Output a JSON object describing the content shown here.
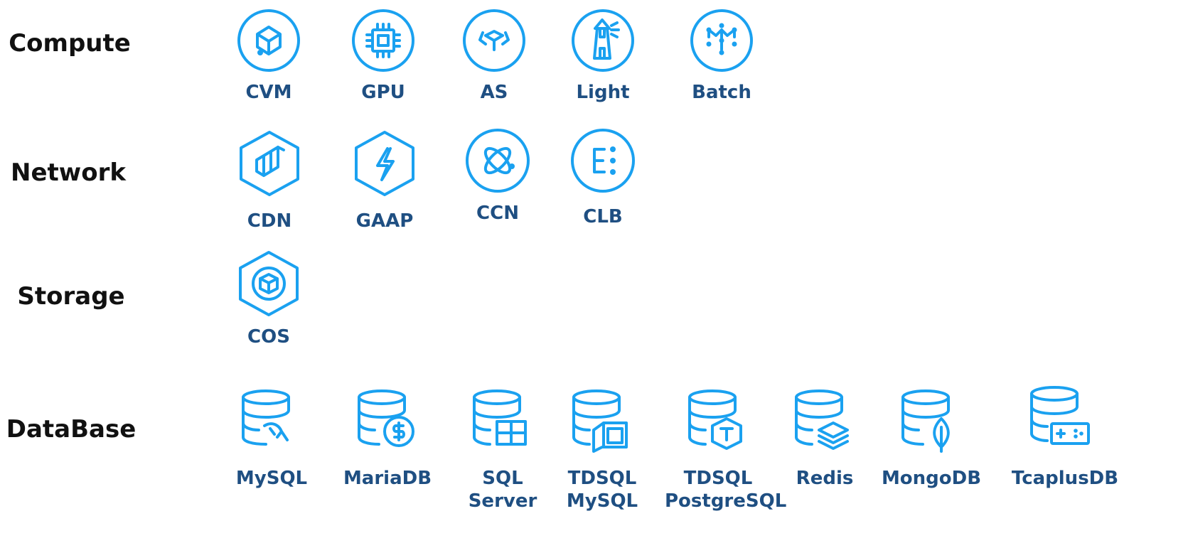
{
  "categories": {
    "compute": "Compute",
    "network": "Network",
    "storage": "Storage",
    "database": "DataBase"
  },
  "compute": [
    {
      "label": "CVM",
      "icon": "cvm-cube-icon"
    },
    {
      "label": "GPU",
      "icon": "chip-icon"
    },
    {
      "label": "AS",
      "icon": "auto-scaling-icon"
    },
    {
      "label": "Light",
      "icon": "lighthouse-icon"
    },
    {
      "label": "Batch",
      "icon": "batch-network-icon"
    }
  ],
  "network": [
    {
      "label": "CDN",
      "icon": "cdn-layers-icon"
    },
    {
      "label": "GAAP",
      "icon": "lightning-icon"
    },
    {
      "label": "CCN",
      "icon": "atom-icon"
    },
    {
      "label": "CLB",
      "icon": "load-balancer-icon"
    }
  ],
  "storage": [
    {
      "label": "COS",
      "icon": "storage-box-icon"
    }
  ],
  "database": [
    {
      "label": "MySQL",
      "icon": "mysql-dolphin-icon"
    },
    {
      "label": "MariaDB",
      "icon": "mariadb-dollar-icon"
    },
    {
      "label": "SQL\nServer",
      "icon": "sql-server-grid-icon"
    },
    {
      "label": "TDSQL\nMySQL",
      "icon": "tdsql-mysql-icon"
    },
    {
      "label": "TDSQL\nPostgreSQL",
      "icon": "tdsql-postgres-icon"
    },
    {
      "label": "Redis",
      "icon": "redis-stack-icon"
    },
    {
      "label": "MongoDB",
      "icon": "mongodb-leaf-icon"
    },
    {
      "label": "TcaplusDB",
      "icon": "tcaplusdb-gamepad-icon"
    }
  ],
  "colors": {
    "icon": "#1aa1f0",
    "label": "#1f4f82",
    "category": "#111111"
  }
}
